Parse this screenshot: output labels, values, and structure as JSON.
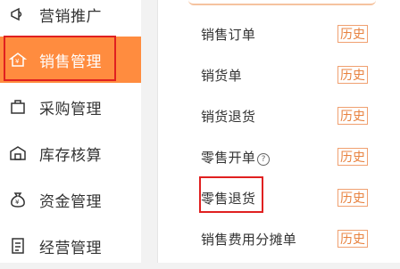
{
  "sidebar": {
    "items": [
      {
        "label": "营销推广",
        "icon": "megaphone-icon",
        "active": false
      },
      {
        "label": "销售管理",
        "icon": "shop-icon",
        "active": true
      },
      {
        "label": "采购管理",
        "icon": "bag-icon",
        "active": false
      },
      {
        "label": "库存核算",
        "icon": "warehouse-icon",
        "active": false
      },
      {
        "label": "资金管理",
        "icon": "money-bag-icon",
        "active": false
      },
      {
        "label": "经营管理",
        "icon": "document-icon",
        "active": false
      }
    ]
  },
  "panel": {
    "rows": [
      {
        "label": "销售订单",
        "history": "历史"
      },
      {
        "label": "销货单",
        "history": "历史"
      },
      {
        "label": "销货退货",
        "history": "历史"
      },
      {
        "label": "零售开单",
        "help": "?",
        "history": "历史"
      },
      {
        "label": "零售退货",
        "history": "历史"
      },
      {
        "label": "销售费用分摊单",
        "history": "历史"
      }
    ]
  },
  "colors": {
    "accent": "#ff8c3f",
    "highlight_border": "#e02020",
    "history_text": "#e8823f"
  }
}
